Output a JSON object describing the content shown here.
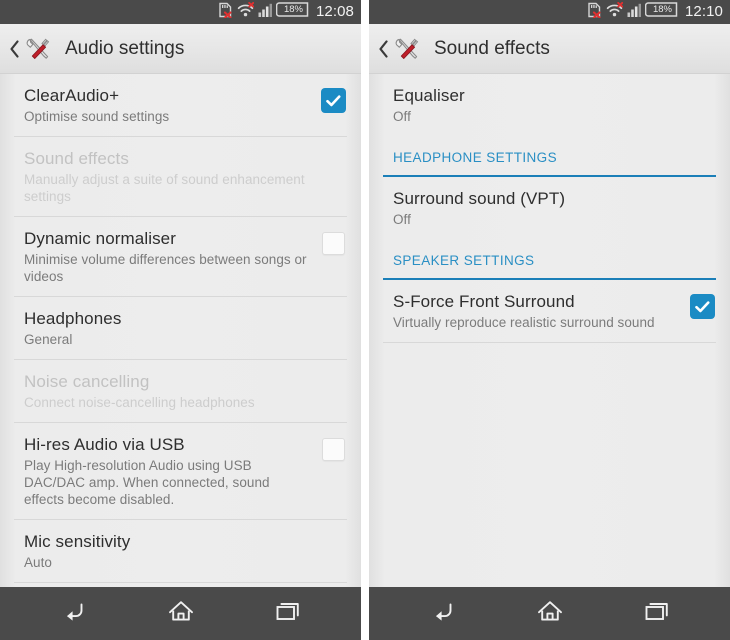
{
  "panels": [
    {
      "statusbar": {
        "clock": "12:08",
        "icons": [
          "sdcard-error-icon",
          "wifi-error-icon",
          "signal-bars-icon",
          "battery-icon"
        ],
        "battery_level": "18%"
      },
      "actionbar": {
        "back_label": "‹",
        "app_icon": "tools-icon",
        "title": "Audio settings"
      },
      "rows": [
        {
          "name": "clearaudio",
          "title": "ClearAudio+",
          "subtitle": "Optimise sound settings",
          "widget": "checkbox",
          "checked": true,
          "disabled": false
        },
        {
          "name": "sound-effects",
          "title": "Sound effects",
          "subtitle": "Manually adjust a suite of sound enhancement settings",
          "widget": "none",
          "checked": false,
          "disabled": true
        },
        {
          "name": "dynamic-normaliser",
          "title": "Dynamic normaliser",
          "subtitle": "Minimise volume differences between songs or videos",
          "widget": "checkbox",
          "checked": false,
          "disabled": false
        },
        {
          "name": "headphones",
          "title": "Headphones",
          "subtitle": "General",
          "widget": "none",
          "checked": false,
          "disabled": false
        },
        {
          "name": "noise-cancelling",
          "title": "Noise cancelling",
          "subtitle": "Connect noise-cancelling headphones",
          "widget": "none",
          "checked": false,
          "disabled": true
        },
        {
          "name": "hi-res-audio-usb",
          "title": "Hi-res Audio via USB",
          "subtitle": "Play High-resolution Audio using USB DAC/DAC amp. When connected, sound effects become disabled.",
          "widget": "checkbox",
          "checked": false,
          "disabled": false
        },
        {
          "name": "mic-sensitivity",
          "title": "Mic sensitivity",
          "subtitle": "Auto",
          "widget": "none",
          "checked": false,
          "disabled": false
        }
      ],
      "navbar": {
        "back": "back-icon",
        "home": "home-icon",
        "recents": "recents-icon"
      }
    },
    {
      "statusbar": {
        "clock": "12:10",
        "icons": [
          "sdcard-error-icon",
          "wifi-error-icon",
          "signal-bars-icon",
          "battery-icon"
        ],
        "battery_level": "18%"
      },
      "actionbar": {
        "back_label": "‹",
        "app_icon": "tools-icon",
        "title": "Sound effects"
      },
      "rows": [
        {
          "name": "equaliser",
          "title": "Equaliser",
          "subtitle": "Off",
          "widget": "none",
          "checked": false,
          "disabled": false
        },
        {
          "name": "headphone-settings-header",
          "kind": "section",
          "title": "HEADPHONE SETTINGS"
        },
        {
          "name": "surround-sound-vpt",
          "title": "Surround sound (VPT)",
          "subtitle": "Off",
          "widget": "none",
          "checked": false,
          "disabled": false
        },
        {
          "name": "speaker-settings-header",
          "kind": "section",
          "title": "SPEAKER SETTINGS"
        },
        {
          "name": "s-force-front-surround",
          "title": "S-Force Front Surround",
          "subtitle": "Virtually reproduce realistic surround sound",
          "widget": "checkbox",
          "checked": true,
          "disabled": false
        }
      ],
      "navbar": {
        "back": "back-icon",
        "home": "home-icon",
        "recents": "recents-icon"
      }
    }
  ],
  "colors": {
    "accent_blue": "#1b8bc4",
    "section_blue": "#2a8fc4",
    "statusbar_bg": "#4a4a4a",
    "list_bg": "#ededed",
    "title_text": "#2e2e2e",
    "sub_text": "#7b7b7b",
    "disabled_text": "#c6c6c6"
  }
}
